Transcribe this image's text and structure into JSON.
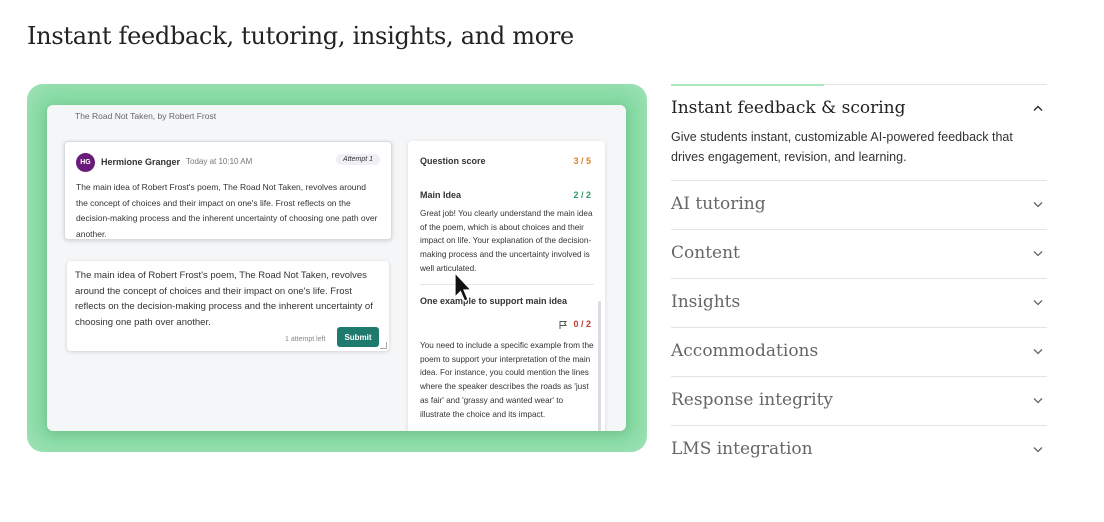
{
  "section_heading": "Instant feedback, tutoring, insights, and more",
  "demo": {
    "passage_title": "The Road Not Taken, by Robert Frost",
    "student": {
      "initials": "HG",
      "name": "Hermione Granger",
      "timestamp": "Today at 10:10 AM",
      "attempt_label": "Attempt 1",
      "response": "The main idea of Robert Frost's poem, The Road Not Taken, revolves around the concept of choices and their impact on one's life. Frost reflects on the decision-making process and the inherent uncertainty of choosing one path over another."
    },
    "editor": {
      "value": "The main idea of Robert Frost's poem, The Road Not Taken, revolves around the concept of choices and their impact on one's life. Frost reflects on the decision-making process and the inherent uncertainty of choosing one path over another.",
      "attempts_left": "1 attempt left",
      "submit_label": "Submit"
    },
    "score_panel": {
      "title": "Question score",
      "total": "3 / 5",
      "criteria": [
        {
          "name": "Main Idea",
          "score": "2 / 2",
          "feedback": "Great job! You clearly understand the main idea of the poem, which is about choices and their impact on life. Your explanation of the decision-making process and the uncertainty involved is well articulated."
        },
        {
          "name": "One example to support main idea",
          "score": "0 / 2",
          "feedback": "You need to include a specific example from the poem to support your interpretation of the main idea. For instance, you could mention the lines where the speaker describes the roads as 'just as fair' and 'grassy and wanted wear' to illustrate the choice and its impact."
        }
      ]
    },
    "colors": {
      "green_score": "#2e9b63",
      "red_score": "#c0392b",
      "orange_score": "#d9822b",
      "accent": "#1f7a6e"
    }
  },
  "accordion": {
    "items": [
      {
        "label": "Instant feedback & scoring",
        "expanded": true,
        "description": "Give students instant, customizable AI-powered feedback that drives engagement, revision, and learning."
      },
      {
        "label": "AI tutoring",
        "expanded": false
      },
      {
        "label": "Content",
        "expanded": false
      },
      {
        "label": "Insights",
        "expanded": false
      },
      {
        "label": "Accommodations",
        "expanded": false
      },
      {
        "label": "Response integrity",
        "expanded": false
      },
      {
        "label": "LMS integration",
        "expanded": false
      }
    ]
  }
}
